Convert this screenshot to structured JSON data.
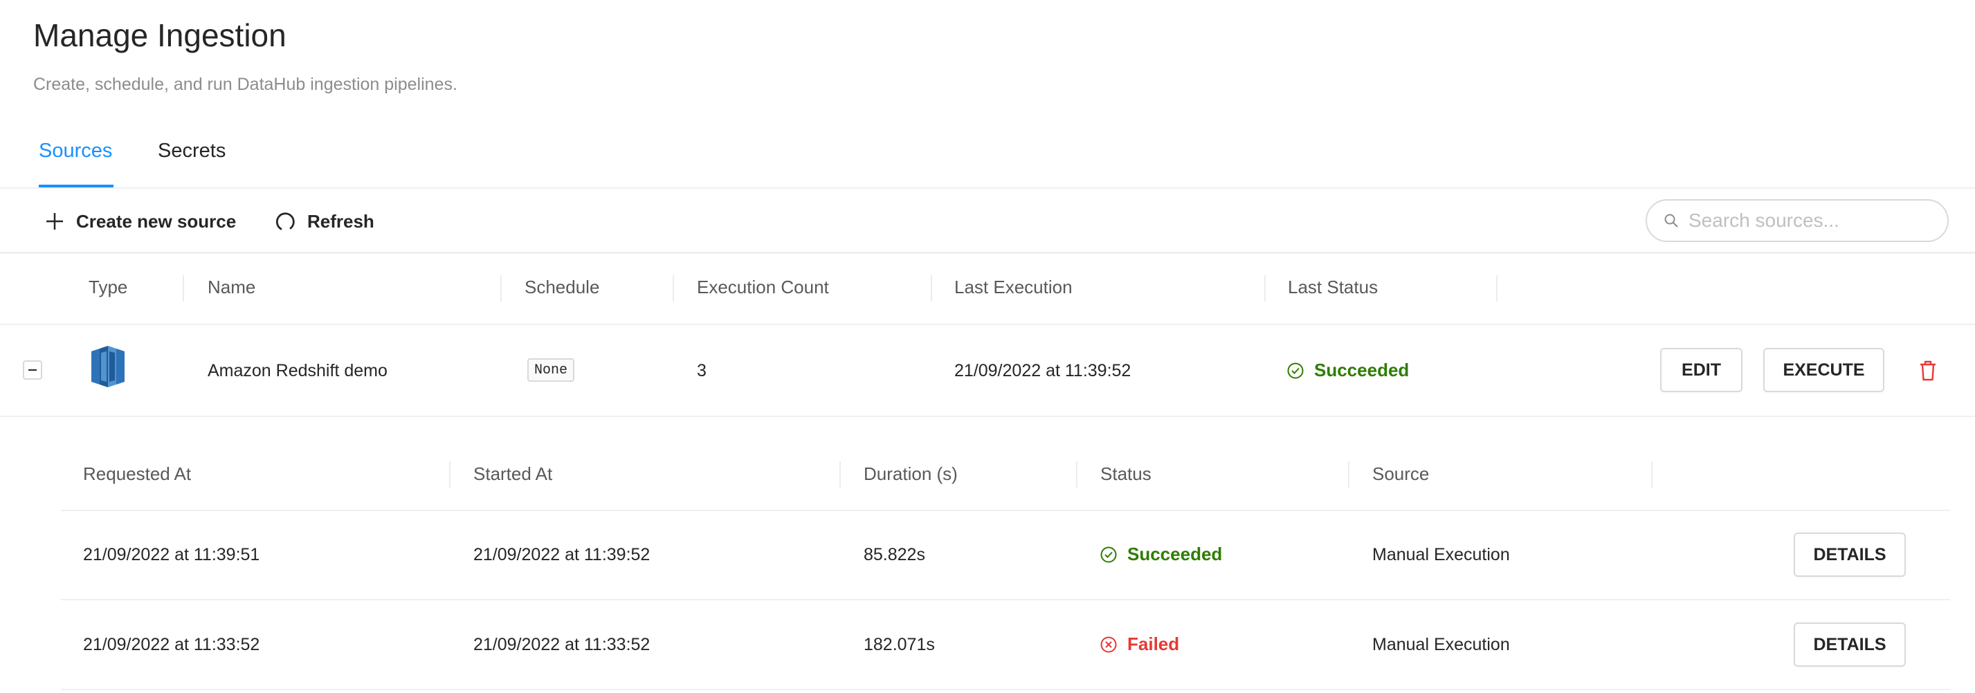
{
  "page": {
    "title": "Manage Ingestion",
    "subtitle": "Create, schedule, and run DataHub ingestion pipelines."
  },
  "tabs": [
    {
      "label": "Sources",
      "active": true
    },
    {
      "label": "Secrets",
      "active": false
    }
  ],
  "toolbar": {
    "create_label": "Create new source",
    "refresh_label": "Refresh",
    "search_placeholder": "Search sources..."
  },
  "table": {
    "columns": [
      "Type",
      "Name",
      "Schedule",
      "Execution Count",
      "Last Execution",
      "Last Status"
    ],
    "rows": [
      {
        "type_icon": "redshift-icon",
        "name": "Amazon Redshift demo",
        "schedule": "None",
        "execution_count": "3",
        "last_execution": "21/09/2022 at 11:39:52",
        "last_status": "Succeeded",
        "edit_label": "EDIT",
        "execute_label": "EXECUTE"
      }
    ]
  },
  "executions": {
    "columns": [
      "Requested At",
      "Started At",
      "Duration (s)",
      "Status",
      "Source"
    ],
    "rows": [
      {
        "requested_at": "21/09/2022 at 11:39:51",
        "started_at": "21/09/2022 at 11:39:52",
        "duration": "85.822s",
        "status": "Succeeded",
        "source": "Manual Execution",
        "details_label": "DETAILS"
      },
      {
        "requested_at": "21/09/2022 at 11:33:52",
        "started_at": "21/09/2022 at 11:33:52",
        "duration": "182.071s",
        "status": "Failed",
        "source": "Manual Execution",
        "details_label": "DETAILS"
      }
    ]
  },
  "colors": {
    "accent": "#1890ff",
    "success": "#2e7d00",
    "error": "#e53935"
  }
}
